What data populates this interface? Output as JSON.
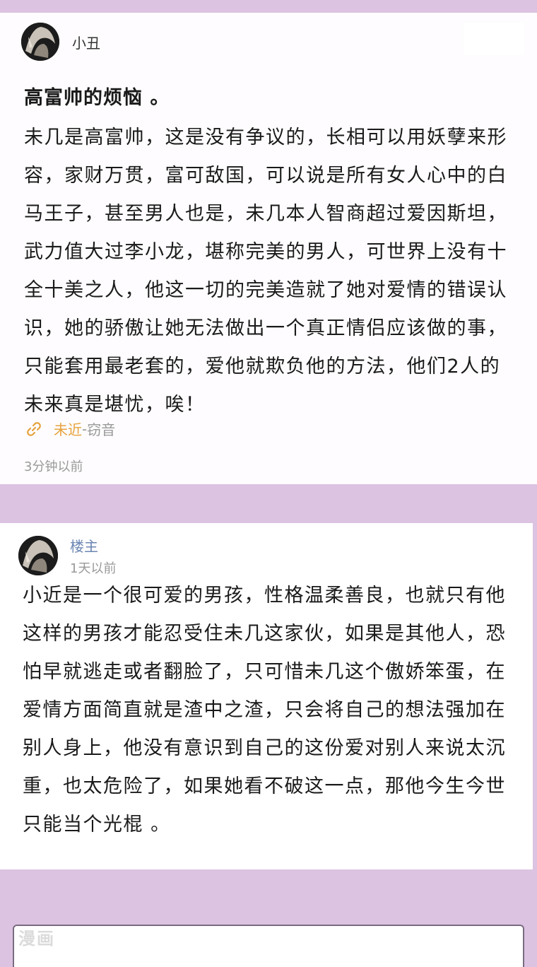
{
  "post": {
    "username": "小丑",
    "title": "高富帅的烦恼 。",
    "body": "未几是高富帅，这是没有争议的，长相可以用妖孽来形容，家财万贯，富可敌国，可以说是所有女人心中的白马王子，甚至男人也是，未几本人智商超过爱因斯坦，武力值大过李小龙，堪称完美的男人，可世界上没有十全十美之人，他这一切的完美造就了她对爱情的错误认识，她的骄傲让她无法做出一个真正情侣应该做的事，只能套用最老套的，爱他就欺负他的方法，他们2人的未来真是堪忧，唉！",
    "source_main": "未近",
    "source_sep": "-",
    "source_sub": "窃音",
    "time": "3分钟以前",
    "link_icon": "link-icon"
  },
  "reply": {
    "username": "楼主",
    "time": "1天以前",
    "body": "小近是一个很可爱的男孩，性格温柔善良，也就只有他这样的男孩才能忍受住未几这家伙，如果是其他人，恐怕早就逃走或者翻脸了，只可惜未几这个傲娇笨蛋，在爱情方面简直就是渣中之渣，只会将自己的想法强加在别人身上，他没有意识到自己的这份爱对别人来说太沉重，也太危险了，如果她看不破这一点，那他今生今世只能当个光棍 。"
  },
  "watermark": "漫画",
  "colors": {
    "background": "#dcc3e1",
    "accent_source": "#e6a23c",
    "owner_name": "#6b86b3"
  }
}
